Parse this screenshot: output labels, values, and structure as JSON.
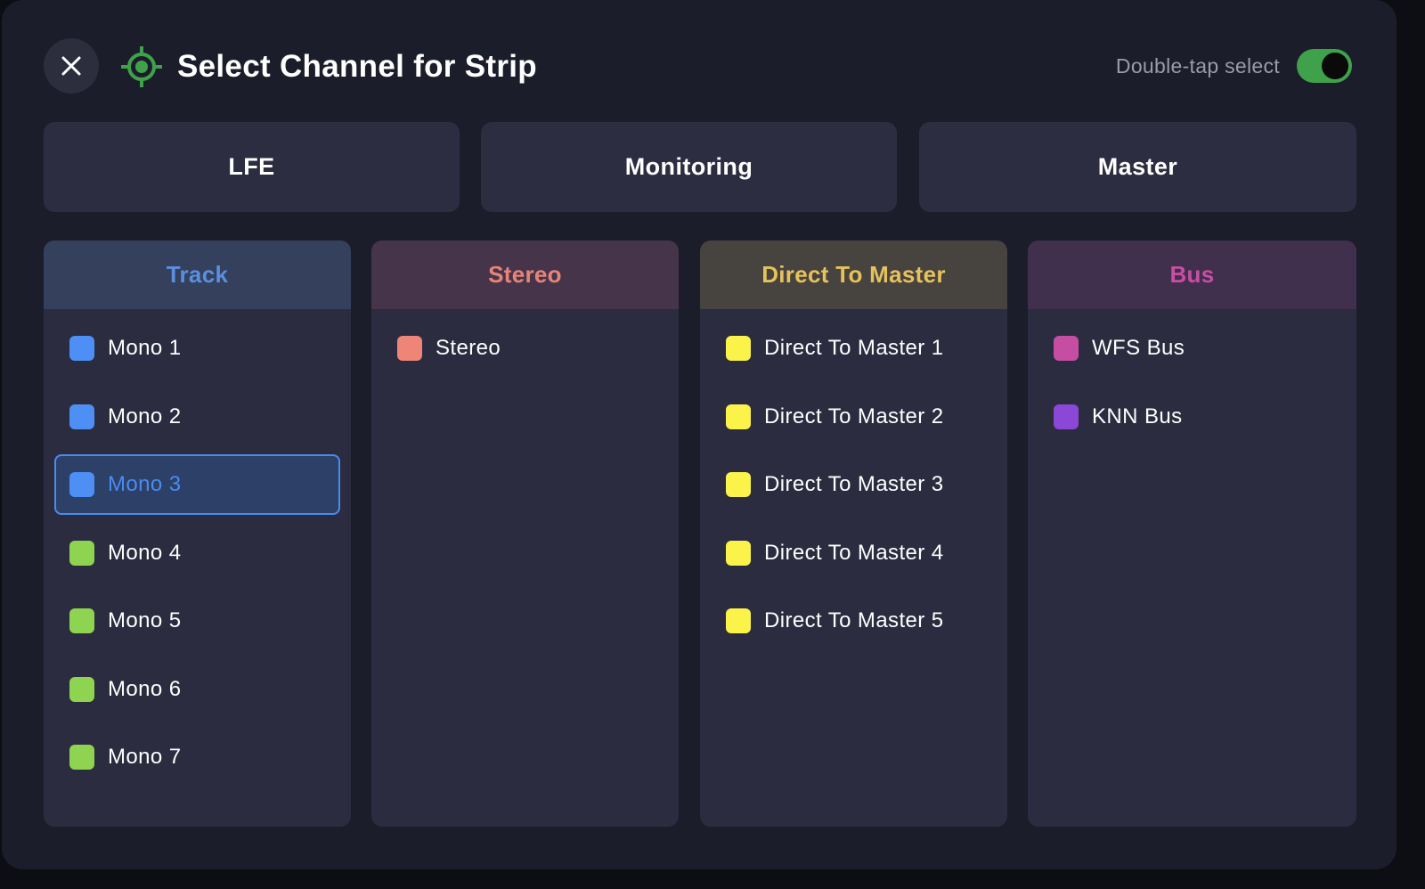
{
  "dialog": {
    "title": "Select Channel for Strip",
    "double_tap_label": "Double-tap select",
    "double_tap_enabled": true
  },
  "quick_buttons": [
    {
      "label": "LFE"
    },
    {
      "label": "Monitoring"
    },
    {
      "label": "Master"
    }
  ],
  "columns": [
    {
      "title": "Track",
      "header_bg": "#34405c",
      "title_color": "#5a8fe0",
      "items": [
        {
          "label": "Mono 1",
          "color": "#4d8ff5",
          "selected": false
        },
        {
          "label": "Mono 2",
          "color": "#4d8ff5",
          "selected": false
        },
        {
          "label": "Mono 3",
          "color": "#4d8ff5",
          "selected": true
        },
        {
          "label": "Mono 4",
          "color": "#8fd450",
          "selected": false
        },
        {
          "label": "Mono 5",
          "color": "#8fd450",
          "selected": false
        },
        {
          "label": "Mono 6",
          "color": "#8fd450",
          "selected": false
        },
        {
          "label": "Mono 7",
          "color": "#8fd450",
          "selected": false
        }
      ]
    },
    {
      "title": "Stereo",
      "header_bg": "#46354a",
      "title_color": "#e58478",
      "items": [
        {
          "label": "Stereo",
          "color": "#ee8577",
          "selected": false
        }
      ]
    },
    {
      "title": "Direct To Master",
      "header_bg": "#47433f",
      "title_color": "#e6c25d",
      "items": [
        {
          "label": "Direct To Master 1",
          "color": "#fbf34a",
          "selected": false
        },
        {
          "label": "Direct To Master 2",
          "color": "#fbf34a",
          "selected": false
        },
        {
          "label": "Direct To Master 3",
          "color": "#fbf34a",
          "selected": false
        },
        {
          "label": "Direct To Master 4",
          "color": "#fbf34a",
          "selected": false
        },
        {
          "label": "Direct To Master 5",
          "color": "#fbf34a",
          "selected": false
        }
      ]
    },
    {
      "title": "Bus",
      "header_bg": "#412f4e",
      "title_color": "#c94ea1",
      "items": [
        {
          "label": "WFS Bus",
          "color": "#c54ea3",
          "selected": false
        },
        {
          "label": "KNN Bus",
          "color": "#8b47d5",
          "selected": false
        }
      ]
    }
  ],
  "icons": {
    "close": "close-icon",
    "target": "target-icon"
  }
}
